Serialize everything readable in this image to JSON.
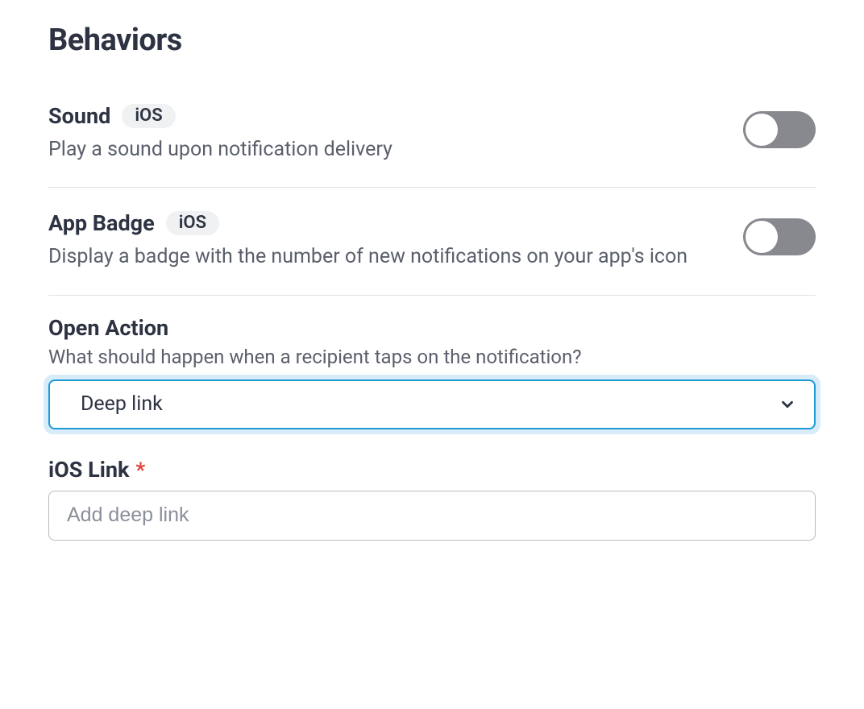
{
  "section_title": "Behaviors",
  "sound": {
    "title": "Sound",
    "badge": "iOS",
    "desc": "Play a sound upon notification delivery",
    "enabled": false
  },
  "app_badge": {
    "title": "App Badge",
    "badge": "iOS",
    "desc": "Display a badge with the number of new notifications on your app's icon",
    "enabled": false
  },
  "open_action": {
    "title": "Open Action",
    "desc": "What should happen when a recipient taps on the notification?",
    "selected": "Deep link"
  },
  "ios_link": {
    "label": "iOS Link",
    "required_marker": "*",
    "placeholder": "Add deep link",
    "value": ""
  }
}
